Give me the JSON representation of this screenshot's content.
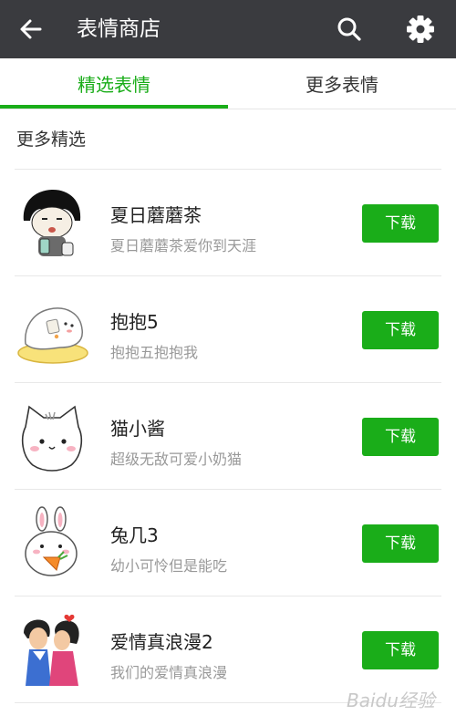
{
  "header": {
    "title": "表情商店",
    "back_icon": "arrow-left-icon",
    "search_icon": "search-icon",
    "settings_icon": "gear-icon",
    "background": "#3a3b3f"
  },
  "tabs": [
    {
      "label": "精选表情",
      "active": true
    },
    {
      "label": "更多表情",
      "active": false
    }
  ],
  "accent_color": "#1aad19",
  "section": {
    "title": "更多精选"
  },
  "items": [
    {
      "name": "夏日蘑蘑茶",
      "desc": "夏日蘑蘑茶爱你到天涯",
      "button": "下载",
      "thumb": "mushroom-head-boy-sticker"
    },
    {
      "name": "抱抱5",
      "desc": "抱抱五抱抱我",
      "button": "下载",
      "thumb": "white-blob-on-cushion-sticker"
    },
    {
      "name": "猫小酱",
      "desc": "超级无敌可爱小奶猫",
      "button": "下载",
      "thumb": "white-kitten-sticker"
    },
    {
      "name": "兔几3",
      "desc": "幼小可怜但是能吃",
      "button": "下载",
      "thumb": "bunny-with-carrot-sticker"
    },
    {
      "name": "爱情真浪漫2",
      "desc": "我们的爱情真浪漫",
      "button": "下载",
      "thumb": "kissing-couple-sticker"
    }
  ],
  "watermark": "Baidu经验"
}
